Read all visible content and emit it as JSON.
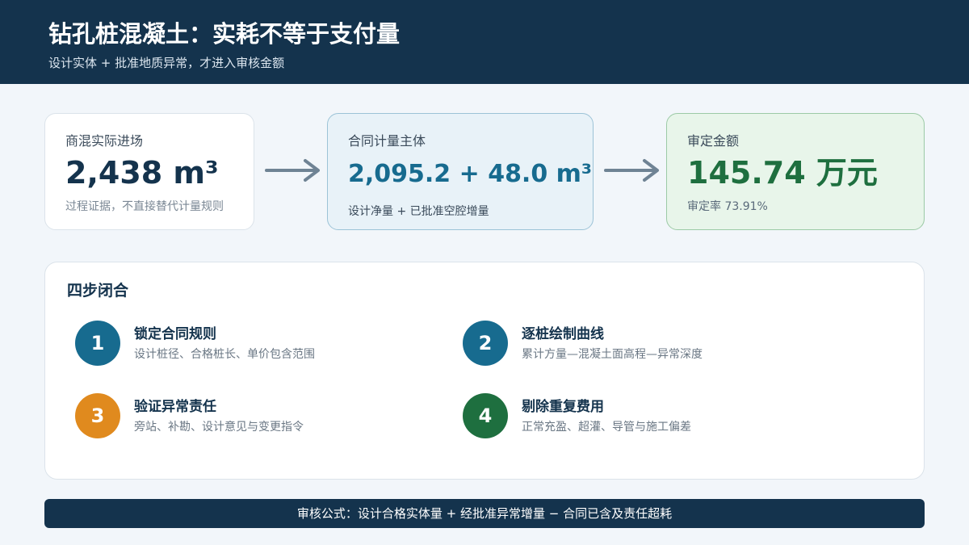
{
  "header": {
    "title": "钻孔桩混凝土：实耗不等于支付量",
    "subtitle": "设计实体 + 批准地质异常，才进入审核金额"
  },
  "cards": [
    {
      "label": "商混实际进场",
      "value": "2,438 m³",
      "note": "过程证据，不直接替代计量规则"
    },
    {
      "label": "合同计量主体",
      "value": "2,095.2 + 48.0 m³",
      "note": "设计净量 + 已批准空腔增量"
    },
    {
      "label": "审定金额",
      "value": "145.74 万元",
      "note": "审定率 73.91%"
    }
  ],
  "colors": {
    "header_bg": "#14334d",
    "step_1": "#176b8f",
    "step_2": "#176b8f",
    "step_3": "#e08a1e",
    "step_4": "#1e6f3f",
    "arrow": "#6f8394"
  },
  "panel": {
    "title": "四步闭合",
    "steps": [
      {
        "num": "1",
        "title": "锁定合同规则",
        "desc": "设计桩径、合格桩长、单价包含范围"
      },
      {
        "num": "2",
        "title": "逐桩绘制曲线",
        "desc": "累计方量—混凝土面高程—异常深度"
      },
      {
        "num": "3",
        "title": "验证异常责任",
        "desc": "旁站、补勘、设计意见与变更指令"
      },
      {
        "num": "4",
        "title": "剔除重复费用",
        "desc": "正常充盈、超灌、导管与施工偏差"
      }
    ]
  },
  "footer": {
    "formula": "审核公式：设计合格实体量 + 经批准异常增量 − 合同已含及责任超耗"
  }
}
